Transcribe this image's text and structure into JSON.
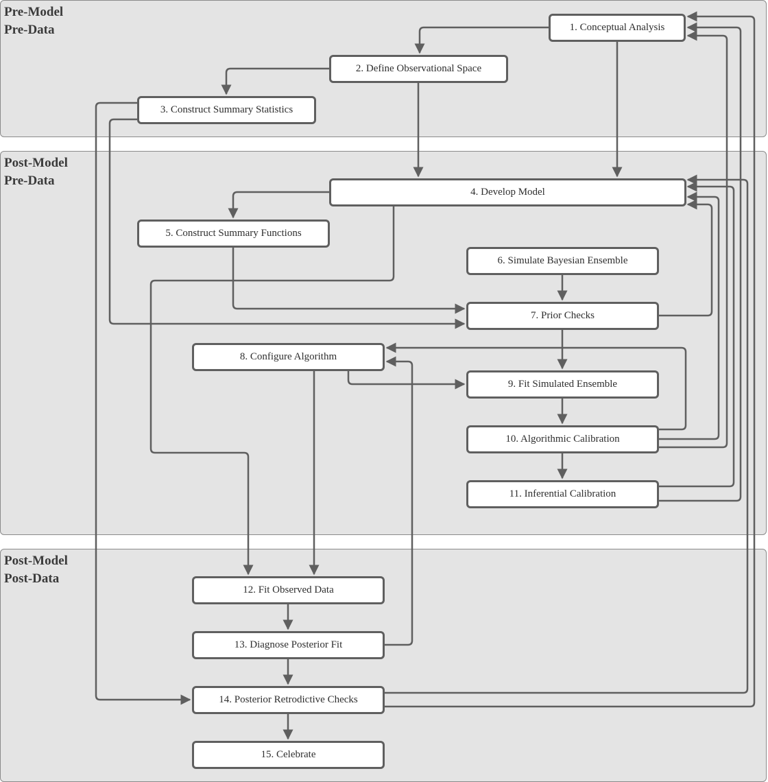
{
  "diagram": {
    "colors": {
      "band_fill": "#e4e4e4",
      "band_border": "#8a8a8a",
      "node_fill": "#ffffff",
      "node_border": "#5f5f5f",
      "edge": "#5f5f5f"
    },
    "phases": [
      {
        "id": "pre-model-pre-data",
        "line1": "Pre-Model",
        "line2": "Pre-Data"
      },
      {
        "id": "post-model-pre-data",
        "line1": "Post-Model",
        "line2": "Pre-Data"
      },
      {
        "id": "post-model-post-data",
        "line1": "Post-Model",
        "line2": "Post-Data"
      }
    ],
    "nodes": [
      {
        "id": 1,
        "label": "1. Conceptual Analysis",
        "phase": "pre-model-pre-data"
      },
      {
        "id": 2,
        "label": "2. Define Observational Space",
        "phase": "pre-model-pre-data"
      },
      {
        "id": 3,
        "label": "3. Construct Summary Statistics",
        "phase": "pre-model-pre-data"
      },
      {
        "id": 4,
        "label": "4. Develop Model",
        "phase": "post-model-pre-data"
      },
      {
        "id": 5,
        "label": "5. Construct Summary Functions",
        "phase": "post-model-pre-data"
      },
      {
        "id": 6,
        "label": "6. Simulate Bayesian Ensemble",
        "phase": "post-model-pre-data"
      },
      {
        "id": 7,
        "label": "7. Prior Checks",
        "phase": "post-model-pre-data"
      },
      {
        "id": 8,
        "label": "8. Configure Algorithm",
        "phase": "post-model-pre-data"
      },
      {
        "id": 9,
        "label": "9. Fit Simulated Ensemble",
        "phase": "post-model-pre-data"
      },
      {
        "id": 10,
        "label": "10. Algorithmic Calibration",
        "phase": "post-model-pre-data"
      },
      {
        "id": 11,
        "label": "11. Inferential Calibration",
        "phase": "post-model-pre-data"
      },
      {
        "id": 12,
        "label": "12. Fit Observed Data",
        "phase": "post-model-post-data"
      },
      {
        "id": 13,
        "label": "13. Diagnose Posterior Fit",
        "phase": "post-model-post-data"
      },
      {
        "id": 14,
        "label": "14. Posterior Retrodictive Checks",
        "phase": "post-model-post-data"
      },
      {
        "id": 15,
        "label": "15. Celebrate",
        "phase": "post-model-post-data"
      }
    ],
    "edges": [
      {
        "from": 1,
        "to": 2
      },
      {
        "from": 1,
        "to": 4
      },
      {
        "from": 2,
        "to": 3
      },
      {
        "from": 2,
        "to": 4
      },
      {
        "from": 3,
        "to": 7
      },
      {
        "from": 3,
        "to": 14
      },
      {
        "from": 4,
        "to": 5
      },
      {
        "from": 4,
        "to": 12
      },
      {
        "from": 5,
        "to": 7
      },
      {
        "from": 6,
        "to": 7
      },
      {
        "from": 7,
        "to": 9
      },
      {
        "from": 7,
        "to": 4
      },
      {
        "from": 8,
        "to": 9
      },
      {
        "from": 8,
        "to": 12
      },
      {
        "from": 9,
        "to": 10
      },
      {
        "from": 10,
        "to": 11
      },
      {
        "from": 10,
        "to": 8
      },
      {
        "from": 10,
        "to": 4
      },
      {
        "from": 10,
        "to": 1
      },
      {
        "from": 11,
        "to": 4
      },
      {
        "from": 11,
        "to": 1
      },
      {
        "from": 12,
        "to": 13
      },
      {
        "from": 13,
        "to": 14
      },
      {
        "from": 13,
        "to": 8
      },
      {
        "from": 14,
        "to": 15
      },
      {
        "from": 14,
        "to": 4
      },
      {
        "from": 14,
        "to": 1
      }
    ]
  }
}
